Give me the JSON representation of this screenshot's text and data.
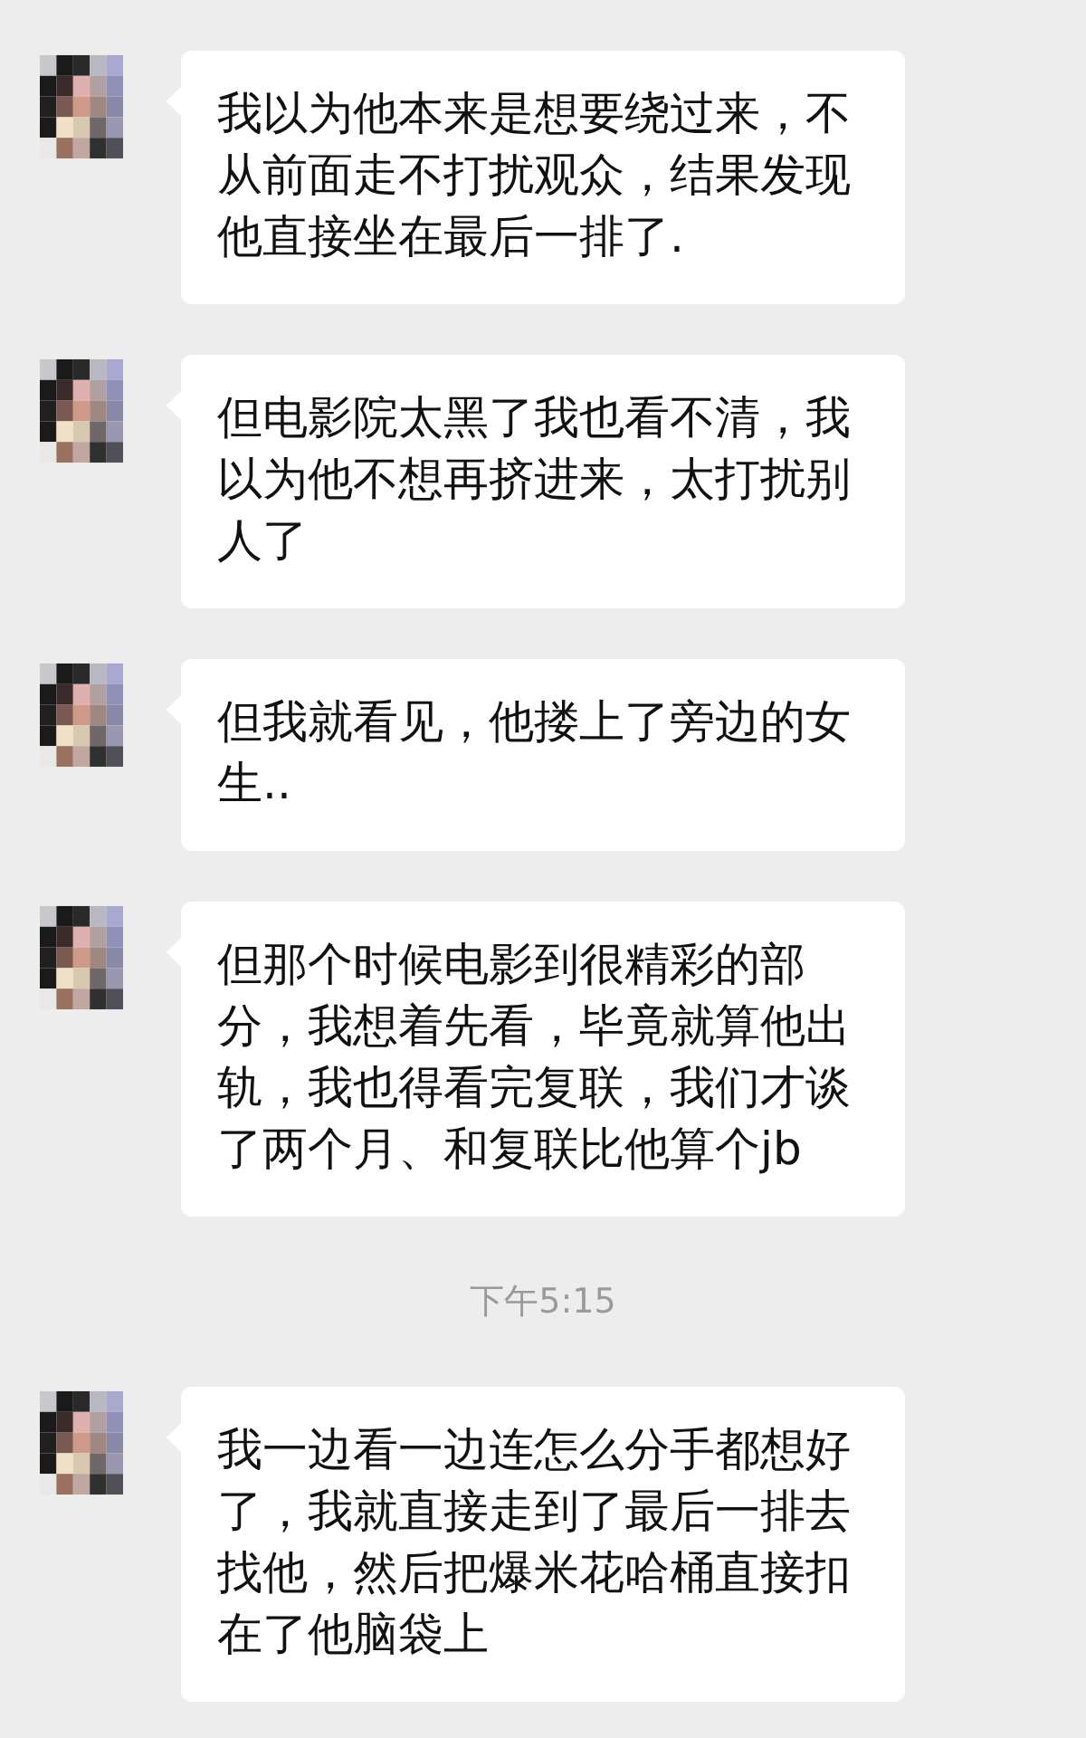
{
  "chat": [
    {
      "kind": "message",
      "text": "我以为他本来是想要绕过来，不从前面走不打扰观众，结果发现他直接坐在最后一排了."
    },
    {
      "kind": "message",
      "text": "但电影院太黑了我也看不清，我以为他不想再挤进来，太打扰别人了"
    },
    {
      "kind": "message",
      "text": "但我就看见，他搂上了旁边的女生.."
    },
    {
      "kind": "message",
      "text": "但那个时候电影到很精彩的部分，我想着先看，毕竟就算他出轨，我也得看完复联，我们才谈了两个月、和复联比他算个jb"
    },
    {
      "kind": "time",
      "text": "下午5:15"
    },
    {
      "kind": "message",
      "text": "我一边看一边连怎么分手都想好了，我就直接走到了最后一排去找他，然后把爆米花哈桶直接扣在了他脑袋上"
    }
  ]
}
